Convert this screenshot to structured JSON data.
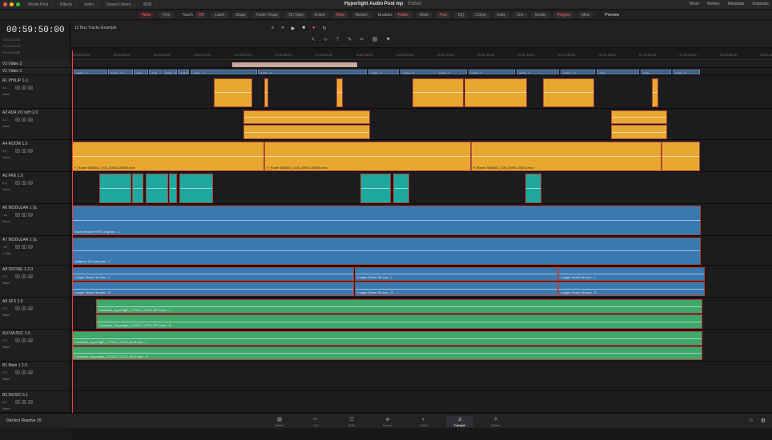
{
  "topbar": {
    "buttons": [
      "Media Pool",
      "Effects",
      "Index",
      "Sound Library",
      "ADR"
    ],
    "title": "Hyperlight Audio Post mp",
    "title_status": "Edited",
    "right": [
      "Mixer",
      "Meters",
      "Metadata",
      "Inspector"
    ]
  },
  "modebar": {
    "left": [
      "Write",
      "Trim"
    ],
    "touch_label": "Touch",
    "touch": [
      "Off",
      "Latch",
      "Snap",
      "Fader Snap"
    ],
    "stop": [
      "On Stop",
      "Event",
      "Hold",
      "Return"
    ],
    "enables_label": "Enables",
    "enables": [
      "Fader",
      "Mute",
      "Pan",
      "EQ",
      "Comp",
      "Gate",
      "Lim",
      "Sends",
      "Plugins",
      "Misc"
    ],
    "preview": "Preview"
  },
  "timecode": "00:59:50:00",
  "timeline_name": "12 Bus Tracks Example",
  "ruler": [
    "00:59:50:00",
    "00:59:58:00",
    "01:00:06:00",
    "01:00:14:00",
    "01:00:22:00",
    "01:00:30:00",
    "01:00:38:00",
    "01:00:46:00",
    "01:00:54:00",
    "01:01:02:00",
    "01:01:10:00",
    "01:01:18:00",
    "01:01:26:00",
    "01:01:34:00",
    "01:01:42:00",
    "01:01:50:00",
    "01:01:58:00",
    "01:02:06:00"
  ],
  "video_tracks": [
    {
      "id": "V2",
      "name": "Video 2"
    },
    {
      "id": "V1",
      "name": "Video 1"
    }
  ],
  "header_tc": [
    "01:02:04:16",
    "01:02:04:16",
    "00:00:00:00"
  ],
  "tracks": [
    {
      "id": "A1",
      "name": "PHILIP",
      "ch": "1.0",
      "vol": "0.0",
      "auto": "None"
    },
    {
      "id": "A2",
      "name": "ADA VO w/H",
      "ch": "2.0",
      "vol": "0.0",
      "auto": "None"
    },
    {
      "id": "A4",
      "name": "ROOM",
      "ch": "1.0",
      "vol": "0.0",
      "auto": "None"
    },
    {
      "id": "A5",
      "name": "FRX",
      "ch": "1.0",
      "vol": "0.0",
      "auto": "None"
    },
    {
      "id": "A6",
      "name": "MODULAR 1",
      "ch": "5c",
      "vol": "-18",
      "auto": "None"
    },
    {
      "id": "A7",
      "name": "MODULAR 2",
      "ch": "5c",
      "vol": "-18",
      "auto": "1 Clip"
    },
    {
      "id": "A8",
      "name": "DRONE 1",
      "ch": "2.0",
      "vol": "0.0",
      "auto": "None"
    },
    {
      "id": "A9",
      "name": "SFX",
      "ch": "2.0",
      "vol": "0.0",
      "auto": "None"
    },
    {
      "id": "A10",
      "name": "MUSIC",
      "ch": "2.0",
      "vol": "0.0",
      "auto": "None"
    },
    {
      "id": "B1",
      "name": "Main 1",
      "ch": "2.0",
      "vol": "0.0",
      "auto": "None"
    },
    {
      "id": "B5",
      "name": "MUSIC",
      "ch": "5.1",
      "vol": "0.0",
      "auto": "None"
    }
  ],
  "clips": {
    "v1": [
      "A001_C...",
      "A001_C1...",
      "A00...",
      "A00...",
      "A001_C...",
      "A001_C...",
      "A001_C...",
      "A001_C...",
      "A001_C...",
      "A001_C...",
      "A001_C...",
      "A001_C..."
    ],
    "room": [
      "F_Room 3M1B41_C00_Z0001 Z0004.mov",
      "F_Room 3M1B41_C00_Z0001 Z0004.mov",
      "F_Room 3M1B41_C00_Z0001 Z0004.mov"
    ],
    "mod1": "Short Wonder HF2 Long.wav - L",
    "mod2": "Adaption 30 Long.wav - L",
    "drone": [
      "Longer Drone 3A.wav - L",
      "Longer Drone 3A.wav - L",
      "Longer Drone 3A.wav - L"
    ],
    "drone2": [
      "Longer Drone 3A.wav - R",
      "Longer Drone 3A.wav - R",
      "Longer Drone 3A.wav - R"
    ],
    "sfx": [
      "Construct_Hyperlight_7/7/2017_2734_SFX.wav - L",
      "Construct_Hyperlight_7/7/2017_2734_SFX.wav - R"
    ],
    "music": [
      "Construct_Hyperlight_7/7/2017_2734_MUS.wav - L",
      "Construct_Hyperlight_7/7/2017_2734_MUS.wav - R"
    ]
  },
  "bottom": {
    "brand": "DaVinci Resolve 15",
    "pages": [
      "Media",
      "Cut",
      "Edit",
      "Fusion",
      "Color",
      "Fairlight",
      "Deliver"
    ],
    "active": "Fairlight"
  }
}
